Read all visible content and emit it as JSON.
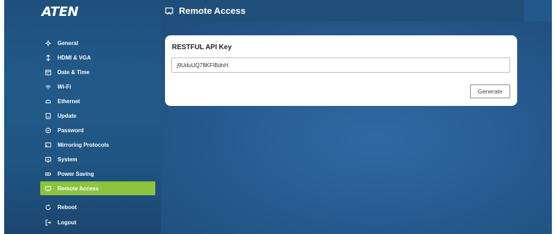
{
  "brand": {
    "logo_text": "ATEN"
  },
  "header": {
    "title": "Remote Access",
    "icon": "remote-access-icon"
  },
  "sidebar": {
    "items": [
      {
        "label": "General",
        "icon": "settings-icon",
        "active": false
      },
      {
        "label": "HDMI & VGA",
        "icon": "input-icon",
        "active": false
      },
      {
        "label": "Date & Time",
        "icon": "calendar-icon",
        "active": false
      },
      {
        "label": "Wi-Fi",
        "icon": "wifi-icon",
        "active": false
      },
      {
        "label": "Ethernet",
        "icon": "ethernet-icon",
        "active": false
      },
      {
        "label": "Update",
        "icon": "update-icon",
        "active": false
      },
      {
        "label": "Password",
        "icon": "password-icon",
        "active": false
      },
      {
        "label": "Mirroring Protocols",
        "icon": "cast-icon",
        "active": false
      },
      {
        "label": "System",
        "icon": "system-icon",
        "active": false
      },
      {
        "label": "Power Saving",
        "icon": "battery-icon",
        "active": false
      },
      {
        "label": "Remote Access",
        "icon": "remote-access-icon",
        "active": true
      },
      {
        "label": "Reboot",
        "icon": "reboot-icon",
        "active": false
      },
      {
        "label": "Logout",
        "icon": "logout-icon",
        "active": false
      }
    ]
  },
  "card": {
    "title": "RESTFUL API Key",
    "api_key_value": "j9UduUQ78KFIBdnH",
    "generate_label": "Generate"
  },
  "colors": {
    "active_item": "#8cc43f",
    "header_bg": "#1f4e79",
    "sidebar_bg": "#215a8a"
  }
}
